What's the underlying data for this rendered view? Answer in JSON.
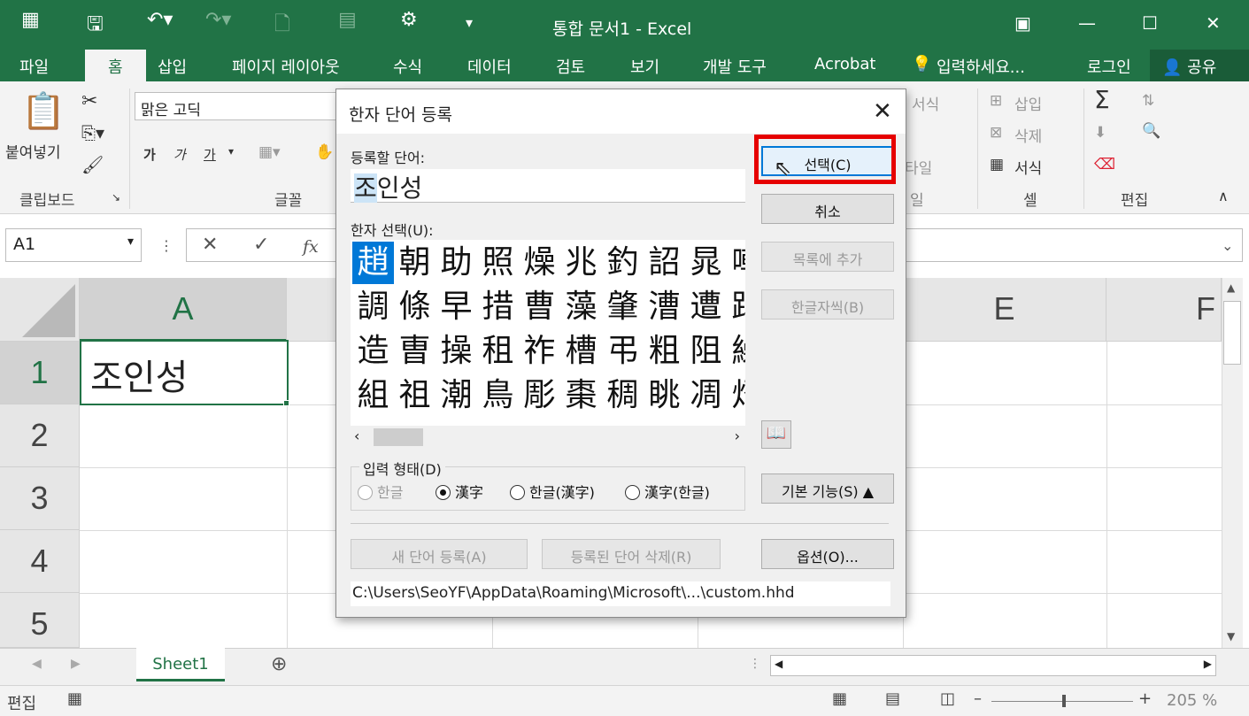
{
  "window": {
    "title": "통합 문서1 - Excel",
    "save_icon": "save-icon",
    "undo_icon": "undo-icon"
  },
  "tabs": [
    "파일",
    "홈",
    "삽입",
    "페이지 레이아웃",
    "수식",
    "데이터",
    "검토",
    "보기",
    "개발 도구",
    "Acrobat"
  ],
  "tell_me": "입력하세요...",
  "signin": "로그인",
  "share": "공유",
  "ribbon": {
    "paste": "붙여넣기",
    "clipboard": "클립보드",
    "font_name": "맑은 고딕",
    "font_group": "글꼴",
    "bold": "가",
    "italic": "가",
    "underline": "가",
    "cond_format": "서식",
    "cells_group": "셀",
    "insert": "삽입",
    "delete": "삭제",
    "format": "서식",
    "edit_group": "편집",
    "style_partial": "타일",
    "style_group_partial": "일"
  },
  "formula_bar": {
    "name_box": "A1",
    "fx": "fx"
  },
  "grid": {
    "columns": [
      "A",
      "E",
      "F"
    ],
    "rows": [
      "1",
      "2",
      "3",
      "4",
      "5"
    ],
    "a1_value": "조인성"
  },
  "sheet": {
    "tab": "Sheet1"
  },
  "status": {
    "mode": "편집",
    "zoom": "205 %"
  },
  "dialog": {
    "title": "한자 단어 등록",
    "word_label": "등록할 단어:",
    "word_first": "조",
    "word_rest": "인성",
    "hanja_label": "한자 선택(U):",
    "hanja_rows": [
      [
        "趙",
        "朝",
        "助",
        "照",
        "燥",
        "兆",
        "釣",
        "詔",
        "晁",
        "嘲"
      ],
      [
        "調",
        "條",
        "早",
        "措",
        "曹",
        "藻",
        "肇",
        "漕",
        "遭",
        "踔"
      ],
      [
        "造",
        "曺",
        "操",
        "租",
        "祚",
        "槽",
        "弔",
        "粗",
        "阻",
        "繰"
      ],
      [
        "組",
        "祖",
        "潮",
        "鳥",
        "彫",
        "棗",
        "稠",
        "眺",
        "凋",
        "炤"
      ]
    ],
    "input_type_label": "입력 형태(D)",
    "radio_hangul": "한글",
    "radio_hanja": "漢字",
    "radio_hangul_hanja": "한글(漢字)",
    "radio_hanja_hangul": "漢字(한글)",
    "btn_select": "선택(C)",
    "btn_cancel": "취소",
    "btn_add_list": "목록에 추가",
    "btn_hangul_meaning": "한글자씩(B)",
    "btn_basic": "기본 기능(S) ▲",
    "btn_new_word": "새 단어 등록(A)",
    "btn_delete_word": "등록된 단어 삭제(R)",
    "btn_options": "옵션(O)...",
    "path": "C:\\Users\\SeoYF\\AppData\\Roaming\\Microsoft\\...\\custom.hhd"
  },
  "colors": {
    "excel_green": "#217346",
    "highlight_red": "#e60000",
    "selection_blue": "#0078d7"
  }
}
